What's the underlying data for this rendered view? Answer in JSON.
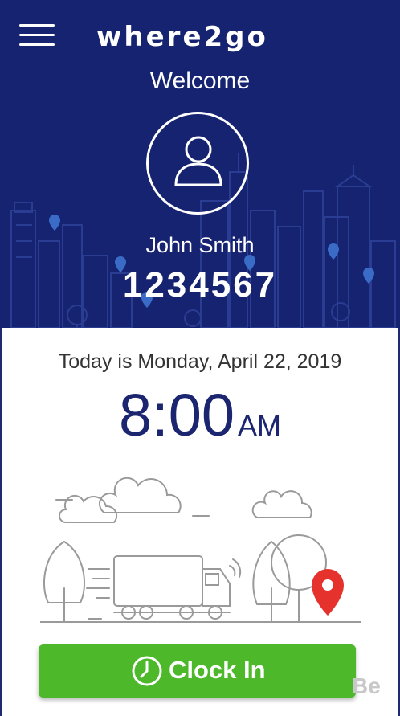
{
  "app": {
    "logo_text": "WHERE2GO",
    "welcome": "Welcome",
    "user_name": "John Smith",
    "employee_id": "1234567"
  },
  "panel": {
    "date_text": "Today is Monday, April 22, 2019",
    "time": "8:00",
    "ampm": "AM"
  },
  "actions": {
    "clock_in_label": "Clock In"
  },
  "watermark": "Be",
  "icons": {
    "menu": "hamburger-icon",
    "avatar": "user-icon",
    "clock": "clock-icon",
    "map_pin": "map-pin-icon"
  },
  "colors": {
    "header_bg": "#152370",
    "time_color": "#1b2570",
    "button_bg": "#4cb82a",
    "pin_red": "#e5322d"
  }
}
